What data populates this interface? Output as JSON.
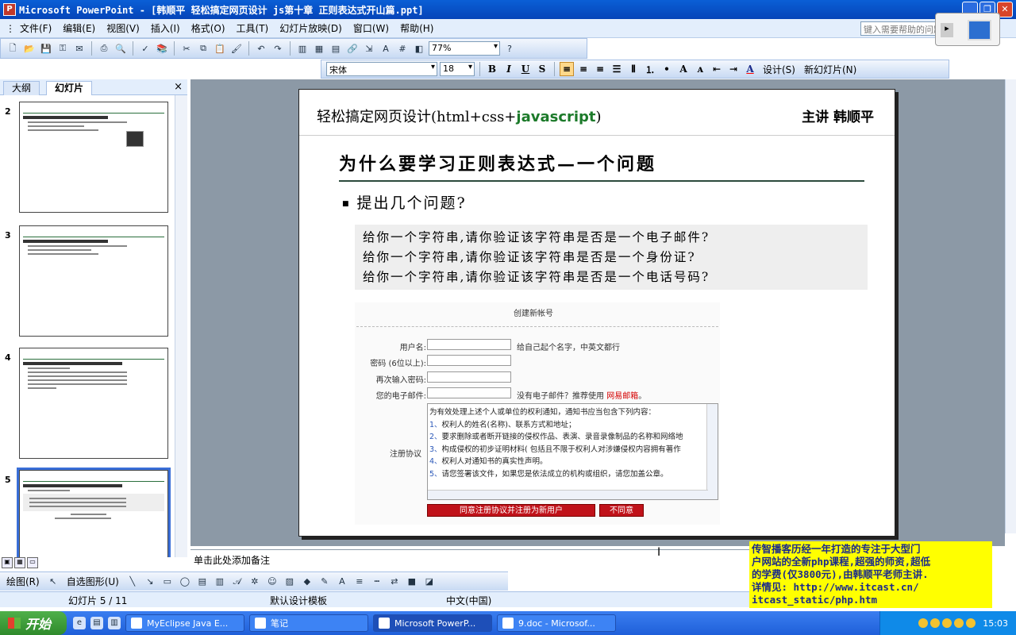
{
  "window": {
    "title": "Microsoft PowerPoint - [韩顺平 轻松搞定网页设计 js第十章 正则表达式开山篇.ppt]",
    "app_icon": "P"
  },
  "menu": {
    "items": [
      "文件(F)",
      "编辑(E)",
      "视图(V)",
      "插入(I)",
      "格式(O)",
      "工具(T)",
      "幻灯片放映(D)",
      "窗口(W)",
      "帮助(H)"
    ],
    "help_placeholder": "键入需要帮助的问题"
  },
  "toolbar": {
    "zoom": "77%",
    "font": "宋体",
    "size": "18",
    "bold": "B",
    "italic": "I",
    "underline": "U",
    "shadow": "S",
    "design": "设计(S)",
    "new_slide": "新幻灯片(N)"
  },
  "pane": {
    "tabs": [
      "大纲",
      "幻灯片"
    ],
    "active_tab": "幻灯片",
    "close": "×",
    "thumbnails": [
      {
        "num": "2"
      },
      {
        "num": "3"
      },
      {
        "num": "4"
      },
      {
        "num": "5"
      }
    ]
  },
  "slide": {
    "brand_prefix": "轻松搞定网页设计(html+css+",
    "brand_js": "javascript",
    "brand_suffix": ")",
    "lecturer": "主讲 韩顺平",
    "title": "为什么要学习正则表达式—一个问题",
    "bullet": "提出几个问题?",
    "questions": [
      "给你一个字符串,请你验证该字符串是否是一个电子邮件?",
      "给你一个字符串,请你验证该字符串是否是一个身份证?",
      "给你一个字符串,请你验证该字符串是否是一个电话号码?"
    ],
    "form": {
      "title": "创建新帐号",
      "username_label": "用户名:",
      "username_hint": "给自己起个名字，中英文都行",
      "password_label": "密码 (6位以上):",
      "confirm_label": "再次输入密码:",
      "email_label": "您的电子邮件:",
      "email_hint": "没有电子邮件？推荐使用",
      "email_link": "网易邮箱",
      "email_hint_end": "。",
      "agreement_label": "注册协议",
      "agreement_intro": "为有效处理上述个人或单位的权利通知，通知书应当包含下列内容：",
      "agreement_lines": [
        {
          "n": "1、",
          "t": "权利人的姓名(名称)、联系方式和地址；"
        },
        {
          "n": "2、",
          "t": "要求删除或者断开链接的侵权作品、表演、录音录像制品的名称和网络地"
        },
        {
          "n": "3、",
          "t": "构成侵权的初步证明材料( 包括且不限于权利人对涉嫌侵权内容拥有著作"
        },
        {
          "n": "4、",
          "t": "权利人对通知书的真实性声明。"
        },
        {
          "n": "5、",
          "t": "请您签署该文件，如果您是依法成立的机构或组织，请您加盖公章。"
        }
      ],
      "agree_button": "同意注册协议并注册为新用户",
      "decline_button": "不同意"
    }
  },
  "notes_placeholder": "单击此处添加备注",
  "ad_text": [
    "传智播客历经一年打造的专注于大型门",
    "户网站的全新php课程,超强的师资,超低",
    "的学费(仅3800元),由韩顺平老师主讲.",
    "详情见: http://www.itcast.cn/",
    "itcast_static/php.htm"
  ],
  "drawbar": {
    "draw": "绘图(R)",
    "autoshapes": "自选图形(U)"
  },
  "status": {
    "slide_count": "幻灯片 5 / 11",
    "template": "默认设计模板",
    "language": "中文(中国)"
  },
  "taskbar": {
    "start": "开始",
    "tasks": [
      "MyEclipse Java E...",
      "笔记",
      "Microsoft PowerP...",
      "9.doc - Microsof..."
    ],
    "active_task": 2,
    "clock": "15:03"
  }
}
